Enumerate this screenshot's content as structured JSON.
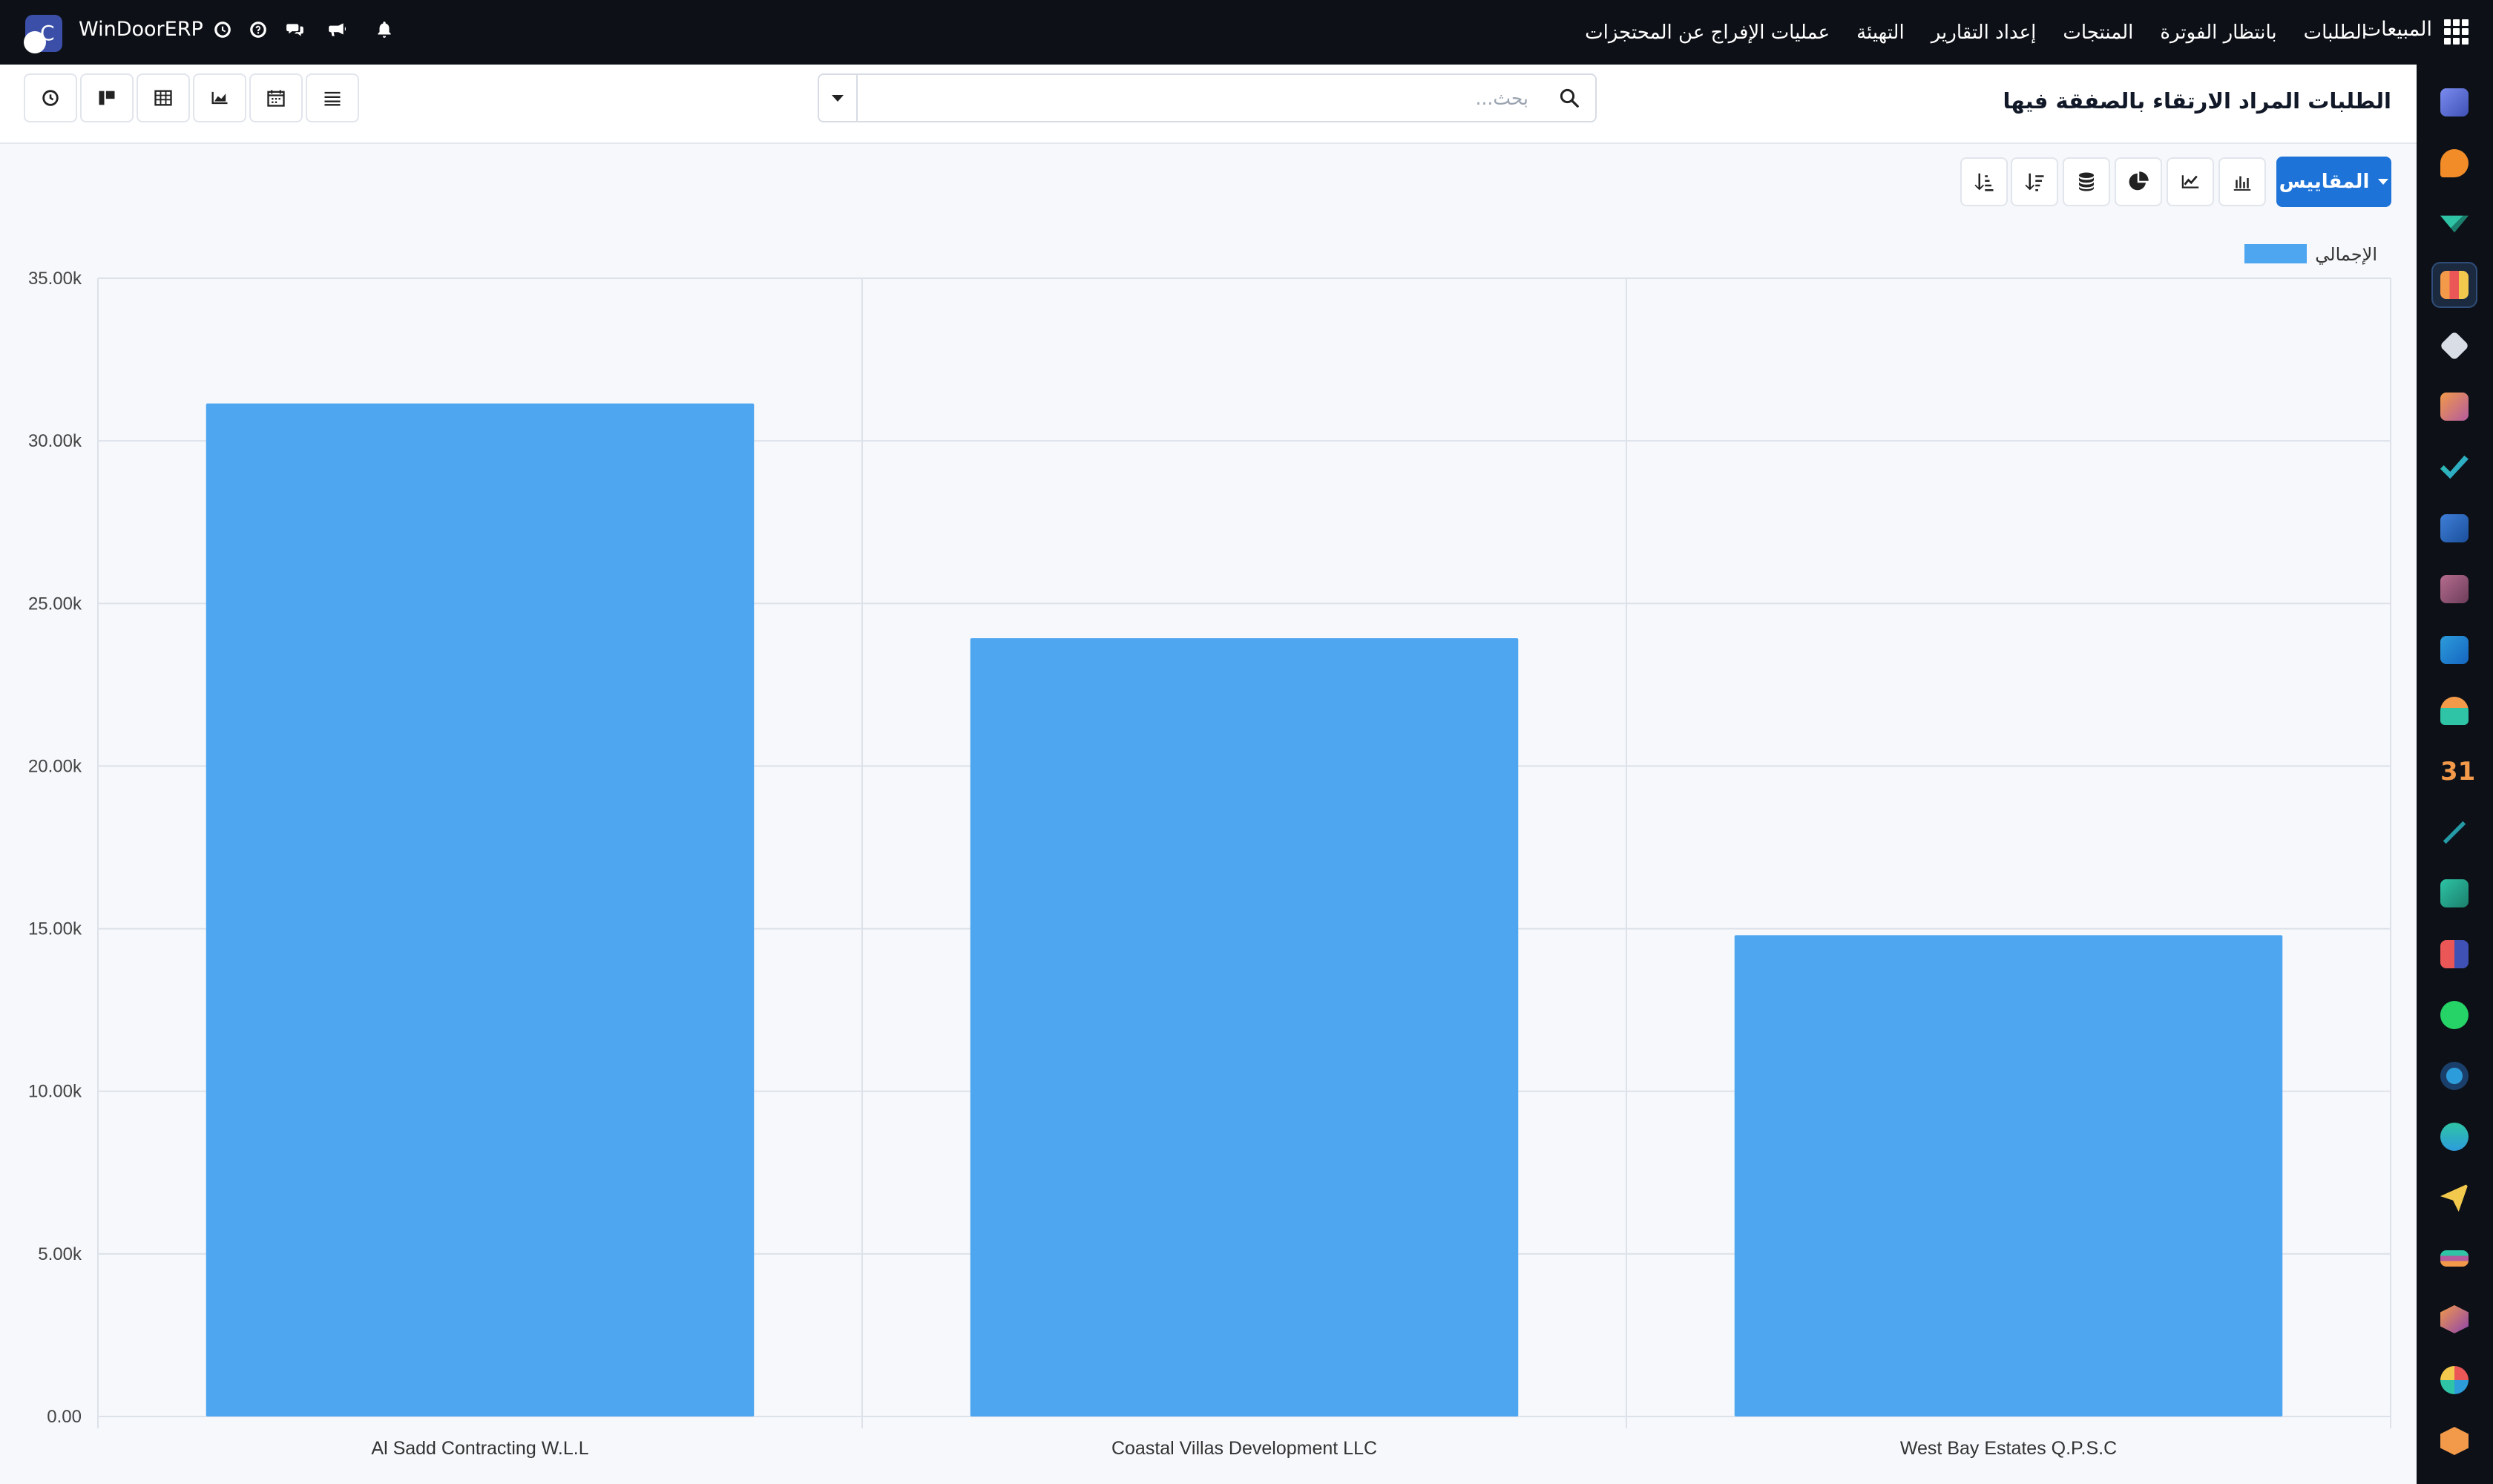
{
  "topbar": {
    "brand_name": "WinDoorERP",
    "brand_letter": "C",
    "app_name": "المبيعات",
    "menu": [
      "الطلبات",
      "بانتظار الفوترة",
      "المنتجات",
      "إعداد التقارير",
      "التهيئة",
      "عمليات الإفراج عن المحتجزات"
    ]
  },
  "control": {
    "title": "الطلبات المراد الارتقاء بالصفقة فيها",
    "search_placeholder": "بحث..."
  },
  "toolbar": {
    "measures_label": "المقاييس"
  },
  "colors": {
    "bar": "#4ea5f0",
    "primary": "#1d73d7",
    "topbar": "#0d1117"
  },
  "chart_data": {
    "type": "bar",
    "categories": [
      "Al Sadd Contracting W.L.L",
      "Coastal Villas Development LLC",
      "West Bay Estates Q.P.S.C"
    ],
    "series": [
      {
        "name": "الإجمالي",
        "values": [
          31150,
          23930,
          14800
        ]
      }
    ],
    "ylim": [
      0,
      35000
    ],
    "yticks": [
      "0.00",
      "5.00k",
      "10.00k",
      "15.00k",
      "20.00k",
      "25.00k",
      "30.00k",
      "35.00k"
    ],
    "grid": true,
    "legend_position": "top-right"
  }
}
